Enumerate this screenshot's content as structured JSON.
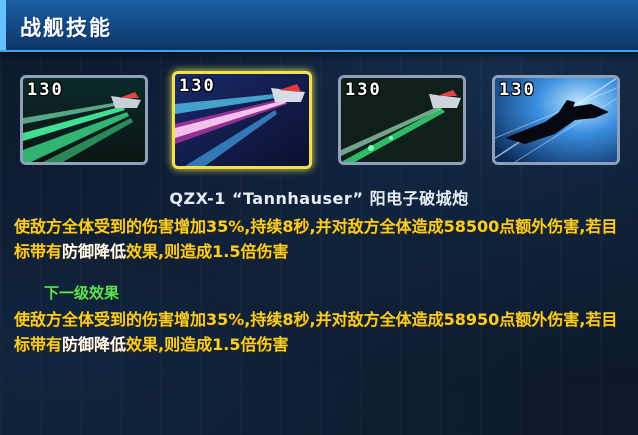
{
  "header": {
    "title": "战舰技能"
  },
  "skills": [
    {
      "cost": "130",
      "icon": "green-laser-beams-icon",
      "selected": false
    },
    {
      "cost": "130",
      "icon": "tannhauser-positron-cannon-icon",
      "selected": true
    },
    {
      "cost": "130",
      "icon": "green-beam-cannon-icon",
      "selected": false
    },
    {
      "cost": "130",
      "icon": "dark-spaceship-silhouette-icon",
      "selected": false
    }
  ],
  "selected_skill": {
    "name": "QZX-1 “Tannhauser” 阳电子破城炮",
    "desc": {
      "part1": "使敌方全体受到的伤害增加35%,持续8秒,并对敌方全体造成58500点额外伤害,若目标带有",
      "highlight": "防御降低",
      "part2": "效果,则造成1.5倍伤害"
    }
  },
  "next_level": {
    "label": "下一级效果",
    "desc": {
      "part1": "使敌方全体受到的伤害增加35%,持续8秒,并对敌方全体造成58950点额外伤害,若目标带有",
      "highlight": "防御降低",
      "part2": "效果,则造成1.5倍伤害"
    }
  },
  "colors": {
    "header_bg": "#134884",
    "selected_border": "#f2e14a",
    "desc_text": "#f6cf2a",
    "next_label": "#5ee05a"
  }
}
